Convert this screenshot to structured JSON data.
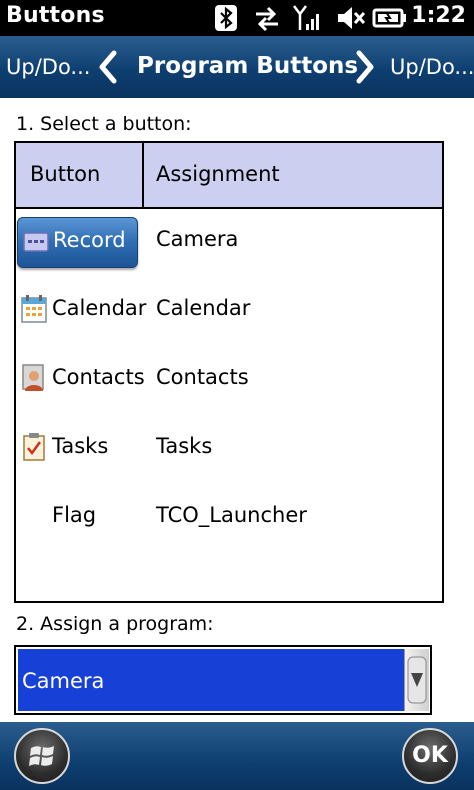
{
  "status_bar": {
    "title": "Buttons",
    "time": "1:22",
    "icons": [
      "bluetooth-icon",
      "data-sync-icon",
      "signal-icon",
      "volume-muted-icon",
      "battery-icon"
    ]
  },
  "tab_bar": {
    "prev_label": "Up/Do...",
    "current_label": "Program Buttons",
    "next_label": "Up/Do..."
  },
  "step1_label": "1. Select a button:",
  "table": {
    "headers": {
      "button": "Button",
      "assignment": "Assignment"
    },
    "rows": [
      {
        "button": "Record",
        "assignment": "Camera",
        "icon": "record-icon",
        "selected": true
      },
      {
        "button": "Calendar",
        "assignment": "Calendar",
        "icon": "calendar-icon"
      },
      {
        "button": "Contacts",
        "assignment": "Contacts",
        "icon": "contacts-icon"
      },
      {
        "button": "Tasks",
        "assignment": "Tasks",
        "icon": "tasks-icon"
      },
      {
        "button": "Flag",
        "assignment": "TCO_Launcher",
        "icon": ""
      }
    ]
  },
  "step2_label": "2. Assign a program:",
  "program_select": {
    "value": "Camera"
  },
  "bottom_bar": {
    "start_icon": "windows-start-icon",
    "ok_label": "OK"
  },
  "colors": {
    "bar_blue": "#0e3f71",
    "header_lavender": "#cccff0",
    "select_blue": "#1740d6",
    "button_blue": "#2f6db2"
  }
}
